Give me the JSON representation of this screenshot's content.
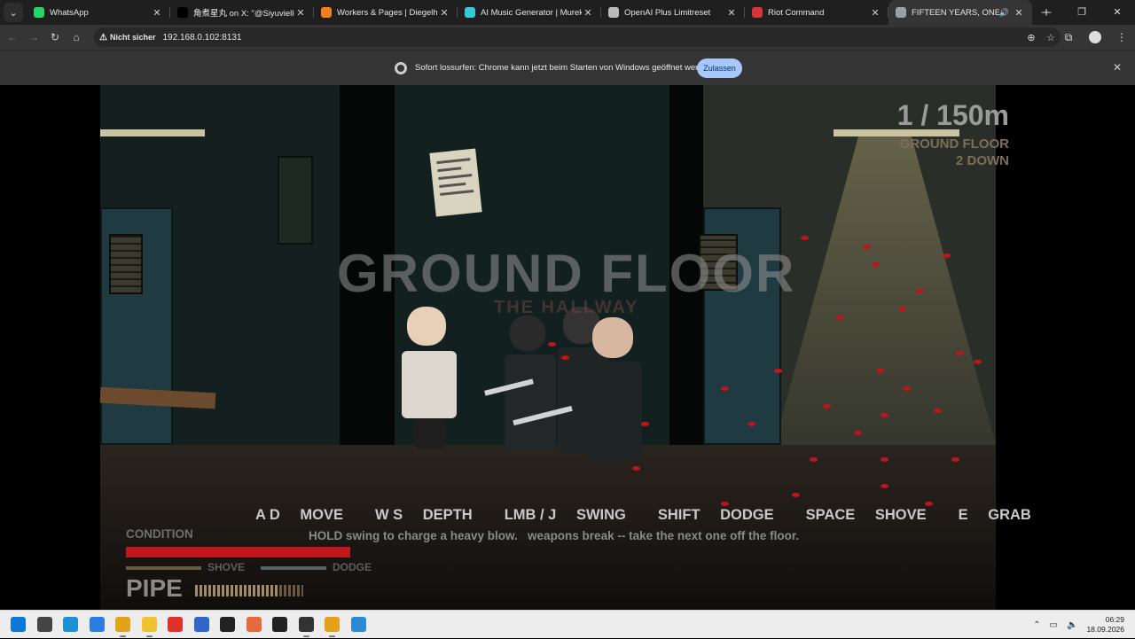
{
  "browser": {
    "tabs": [
      {
        "title": "WhatsApp",
        "icon": "whatsapp-icon",
        "color": "#25d366",
        "active": false
      },
      {
        "title": "角煮星丸 on X: \"@Siyuvielle そう",
        "icon": "x-logo-icon",
        "color": "#000000",
        "active": false
      },
      {
        "title": "Workers & Pages | Diegelholz@",
        "icon": "cloudflare-icon",
        "color": "#f38020",
        "active": false
      },
      {
        "title": "AI Music Generator | Mureka",
        "icon": "mureka-icon",
        "color": "#35c8d6",
        "active": false
      },
      {
        "title": "OpenAI Plus Limitreset",
        "icon": "openai-icon",
        "color": "#bbbbbb",
        "active": false
      },
      {
        "title": "Riot Command",
        "icon": "riot-icon",
        "color": "#d13639",
        "active": false
      },
      {
        "title": "FIFTEEN YEARS, ONE CORRI",
        "icon": "globe-icon",
        "color": "#9aa0a6",
        "active": true
      }
    ],
    "new_tab_label": "+",
    "security_label": "Nicht sicher",
    "url": "192.168.0.102:8131",
    "infobar": {
      "message": "Sofort lossurfen: Chrome kann jetzt beim Starten von Windows geöffnet werden.",
      "button_label": "Zulassen"
    }
  },
  "game": {
    "distance": "1 / 150m",
    "floor_name": "GROUND FLOOR",
    "floors_down": "2 DOWN",
    "banner_title": "GROUND FLOOR",
    "banner_subtitle": "THE HALLWAY",
    "controls": [
      {
        "keys": "A D",
        "action": "MOVE"
      },
      {
        "keys": "W S",
        "action": "DEPTH"
      },
      {
        "keys": "LMB / J",
        "action": "SWING"
      },
      {
        "keys": "SHIFT",
        "action": "DODGE"
      },
      {
        "keys": "SPACE",
        "action": "SHOVE"
      },
      {
        "keys": "E",
        "action": "GRAB"
      }
    ],
    "hint": "HOLD swing to charge a heavy blow.   weapons break -- take the next one off the floor.",
    "hud": {
      "condition_label": "CONDITION",
      "condition_level": 1.0,
      "shove_label": "SHOVE",
      "dodge_label": "DODGE",
      "weapon": "PIPE",
      "weapon_durability": 0.78
    },
    "colors": {
      "blood": "#c0141a",
      "condition": "#c0171d"
    }
  },
  "taskbar": {
    "apps": [
      "windows-start-icon",
      "task-view-icon",
      "edge-icon",
      "store-icon",
      "chrome-icon",
      "file-explorer-icon",
      "youtube-music-icon",
      "powershell-icon",
      "notion-icon",
      "claude-icon",
      "chatgpt-icon",
      "terminal-icon",
      "chrome-icon",
      "paint-icon"
    ],
    "time": "06:29",
    "date": "18.09.2026"
  }
}
